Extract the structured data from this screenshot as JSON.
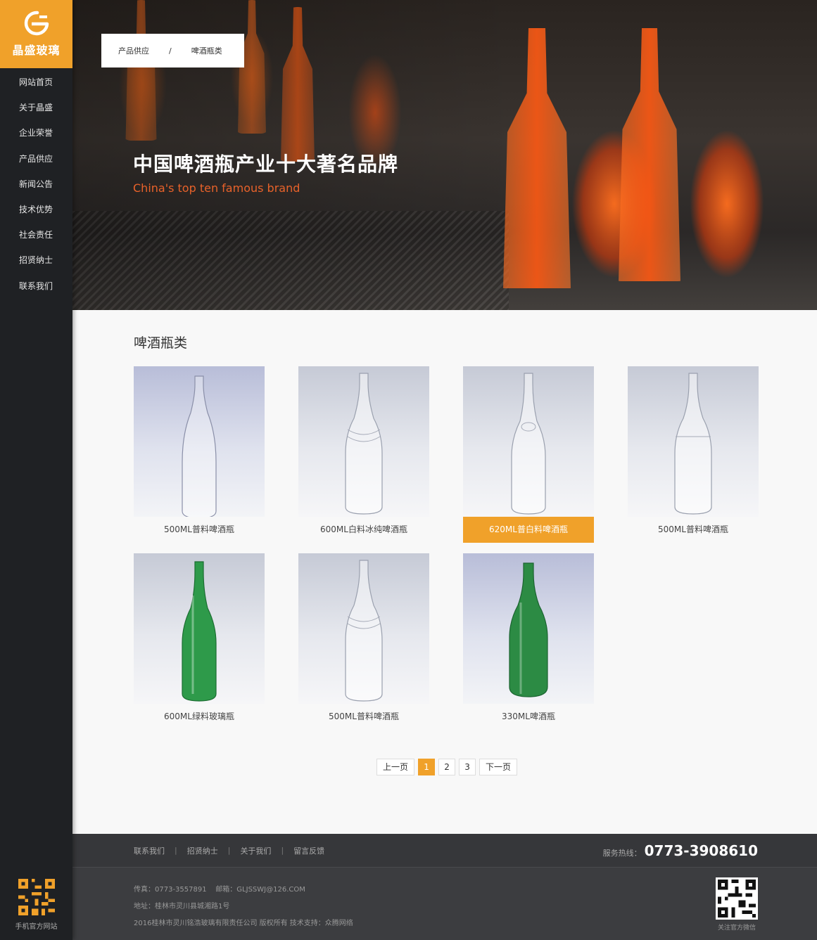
{
  "brand": {
    "name": "晶盛玻璃",
    "accent": "#f0a12a"
  },
  "sidebar": {
    "items": [
      {
        "label": "网站首页"
      },
      {
        "label": "关于晶盛"
      },
      {
        "label": "企业荣誉"
      },
      {
        "label": "产品供应"
      },
      {
        "label": "新闻公告"
      },
      {
        "label": "技术优势"
      },
      {
        "label": "社会责任"
      },
      {
        "label": "招贤纳士"
      },
      {
        "label": "联系我们"
      }
    ],
    "qr_caption": "手机官方网站"
  },
  "breadcrumb": {
    "parent": "产品供应",
    "separator": "/",
    "current": "啤酒瓶类"
  },
  "banner": {
    "title": "中国啤酒瓶产业十大著名品牌",
    "subtitle": "China's top ten famous brand"
  },
  "section": {
    "title": "啤酒瓶类"
  },
  "products": [
    {
      "name": "500ML普料啤酒瓶",
      "color": "clear",
      "active": false
    },
    {
      "name": "600ML白料冰纯啤酒瓶",
      "color": "clear",
      "active": false
    },
    {
      "name": "620ML普白料啤酒瓶",
      "color": "clear",
      "active": true
    },
    {
      "name": "500ML普料啤酒瓶",
      "color": "clear",
      "active": false
    },
    {
      "name": "600ML绿料玻璃瓶",
      "color": "green",
      "active": false
    },
    {
      "name": "500ML普料啤酒瓶",
      "color": "clear",
      "active": false
    },
    {
      "name": "330ML啤酒瓶",
      "color": "green",
      "active": false
    }
  ],
  "pagination": {
    "prev": "上一页",
    "pages": [
      "1",
      "2",
      "3"
    ],
    "current": "1",
    "next": "下一页"
  },
  "footer": {
    "links": [
      "联系我们",
      "招贤纳士",
      "关于我们",
      "留言反馈"
    ],
    "link_separator": "|",
    "hotline_label": "服务热线：",
    "hotline": "0773-3908610",
    "fax": "传真：0773-3557891",
    "email": "邮箱：GLJSSWJ@126.COM",
    "address": "地址：桂林市灵川县城湘路1号",
    "copyright": "2016桂林市灵川铭浩玻璃有限责任公司 版权所有 技术支持：众腾网络",
    "qr_caption": "关注官方微信"
  }
}
